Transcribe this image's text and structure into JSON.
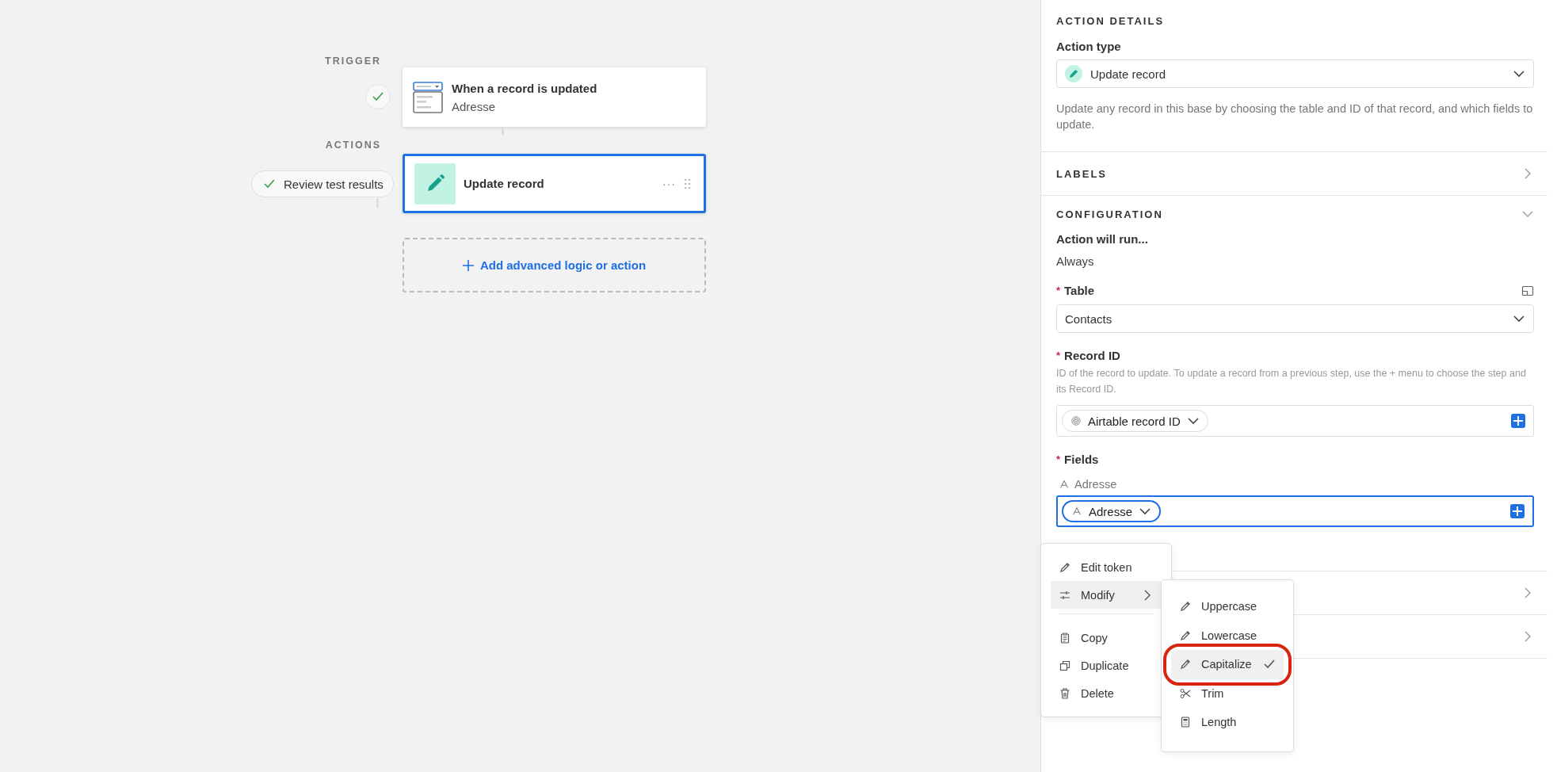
{
  "canvas": {
    "trigger": {
      "section_label": "TRIGGER",
      "title": "When a record is updated",
      "subtitle": "Adresse",
      "tested": true
    },
    "actions": {
      "section_label": "ACTIONS",
      "test_button": "Review test results",
      "tested": true,
      "steps": [
        {
          "title": "Update record",
          "selected": true,
          "more": "···"
        }
      ],
      "add_button": "Add advanced logic or action"
    }
  },
  "panel": {
    "action_details": {
      "heading": "ACTION DETAILS",
      "action_type_label": "Action type",
      "action_type_value": "Update record",
      "description": "Update any record in this base by choosing the table and ID of that record, and which fields to update."
    },
    "labels_section": {
      "heading": "LABELS",
      "expanded": false
    },
    "configuration": {
      "heading": "CONFIGURATION",
      "expanded": true,
      "run_label": "Action will run...",
      "run_value": "Always",
      "table": {
        "label": "Table",
        "required_mark": "*",
        "value": "Contacts"
      },
      "record_id": {
        "label": "Record ID",
        "required_mark": "*",
        "hint": "ID of the record to update. To update a record from a previous step, use the + menu to choose the step and its Record ID.",
        "token": "Airtable record ID"
      },
      "fields": {
        "label": "Fields",
        "required_mark": "*",
        "field_name": "Adresse",
        "token": "Adresse",
        "focused": true
      }
    },
    "more_sections": [
      {
        "expanded": false
      },
      {
        "expanded": false
      }
    ]
  },
  "context_menu": {
    "items": [
      {
        "kind": "edit",
        "label": "Edit token",
        "selected": false
      },
      {
        "kind": "submenu",
        "label": "Modify",
        "selected": true
      },
      {
        "kind": "divider"
      },
      {
        "kind": "copy",
        "label": "Copy",
        "selected": false
      },
      {
        "kind": "duplicate",
        "label": "Duplicate",
        "selected": false
      },
      {
        "kind": "delete",
        "label": "Delete",
        "selected": false
      }
    ],
    "submenu": {
      "items": [
        {
          "kind": "edit",
          "label": "Uppercase",
          "selected": false,
          "checked": false,
          "circled": false
        },
        {
          "kind": "edit",
          "label": "Lowercase",
          "selected": false,
          "checked": false,
          "circled": false
        },
        {
          "kind": "edit",
          "label": "Capitalize",
          "selected": true,
          "checked": true,
          "circled": true
        },
        {
          "kind": "trim",
          "label": "Trim",
          "selected": false,
          "checked": false,
          "circled": false
        },
        {
          "kind": "length",
          "label": "Length",
          "selected": false,
          "checked": false,
          "circled": false
        }
      ]
    }
  }
}
